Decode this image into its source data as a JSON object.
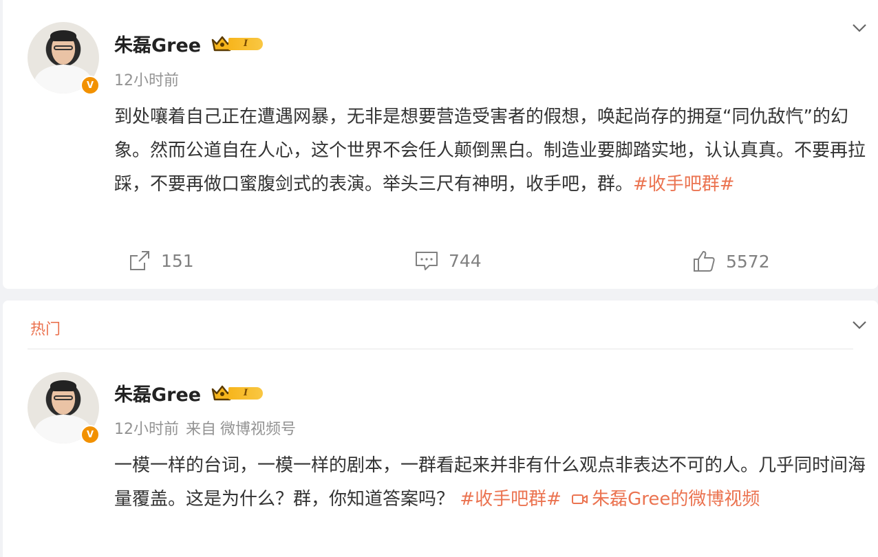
{
  "posts": [
    {
      "author": "朱磊Gree",
      "vip_level": "I",
      "time": "12小时前",
      "source_prefix": "",
      "source": "",
      "text": "到处嚷着自己正在遭遇网暴，无非是想要营造受害者的假想，唤起尚存的拥趸“同仇敌忾”的幻象。然而公道自在人心，这个世界不会任人颠倒黑白。制造业要脚踏实地，认认真真。不要再拉踩，不要再做口蜜腹剑式的表演。举头三尺有神明，收手吧，群。",
      "hashtag": "#收手吧群#",
      "video_link": "",
      "stats": {
        "repost": "151",
        "comment": "744",
        "like": "5572"
      }
    },
    {
      "section_label": "热门",
      "author": "朱磊Gree",
      "vip_level": "I",
      "time": "12小时前",
      "source_prefix": "来自",
      "source": "微博视频号",
      "text": "一模一样的台词，一模一样的剧本，一群看起来并非有什么观点非表达不可的人。几乎同时间海量覆盖。这是为什么？群，你知道答案吗？",
      "hashtag": "#收手吧群#",
      "video_link": "朱磊Gree的微博视频"
    }
  ],
  "icons": {
    "verified": "V",
    "menu": "chevron-down-icon",
    "repost": "repost-icon",
    "comment": "comment-icon",
    "like": "thumbs-up-icon",
    "video": "video-camera-icon"
  },
  "colors": {
    "accent": "#eb7350",
    "verified_badge": "#f29100",
    "vip_gold": "#f7b51c",
    "meta_gray": "#939393"
  }
}
